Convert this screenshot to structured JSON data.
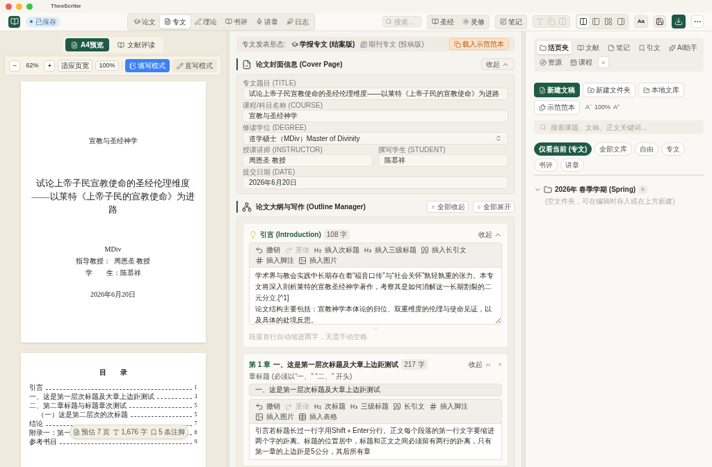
{
  "window": {
    "title": "TheoScribe"
  },
  "toolbar": {
    "save_status": "已保存",
    "modes": [
      {
        "label": "论文",
        "selected": false
      },
      {
        "label": "专文",
        "selected": true
      },
      {
        "label": "理论",
        "selected": false
      },
      {
        "label": "书评",
        "selected": false
      },
      {
        "label": "讲章",
        "selected": false
      },
      {
        "label": "日志",
        "selected": false
      }
    ],
    "search": {
      "placeholder": "搜索..."
    },
    "resources": [
      "圣经",
      "灵修"
    ],
    "notes": "笔记",
    "edit_buttons": [
      {
        "disabled": true
      },
      {
        "disabled": true
      },
      {
        "disabled": true
      }
    ],
    "layout_buttons": [
      {
        "selected": true
      },
      {
        "selected": false
      },
      {
        "selected": false
      },
      {
        "selected": false
      }
    ],
    "font_button": "Aa"
  },
  "preview": {
    "tabs": [
      {
        "label": "A4预览",
        "selected": true
      },
      {
        "label": "文献评读",
        "selected": false
      }
    ],
    "zoom": {
      "minus": "−",
      "value": "62%",
      "plus": "+",
      "fit": "适应页宽",
      "actual": "100%"
    },
    "modes": [
      {
        "label": "填写模式",
        "selected": true
      },
      {
        "label": "直写模式",
        "selected": false
      }
    ],
    "cover": {
      "course": "宣教与圣经神学",
      "title": "试论上帝子民宣教使命的圣经伦理维度",
      "subtitle": "——以莱特《上帝子民的宣教使命》为进路",
      "degree": "MDiv",
      "instructor": "指导教授：  周恩圣 教授",
      "student": "学　　生：陈慕祥",
      "date": "2026年6月20日"
    },
    "toc": {
      "title": "目　　录",
      "entries": [
        {
          "label": "引言",
          "page": "1"
        },
        {
          "label": "一、这是第一层次标题及大章上边距测试",
          "page": "3"
        },
        {
          "label": "二、第二章标题与标题章次测试",
          "page": "5",
          "children": [
            {
              "label": "（一）这是第二层次的次标题",
              "page": "5"
            }
          ]
        },
        {
          "label": "结论",
          "page": "7"
        },
        {
          "label": "附录一：第一",
          "page": "8"
        },
        {
          "label": "参考书目",
          "page": "9"
        }
      ]
    },
    "stats": [
      "预估 7 页",
      "1,676 字",
      "5 条注脚"
    ]
  },
  "editor": {
    "publish": {
      "label": "专文发表形态:",
      "options": [
        {
          "label": "学报专文 (结案版)",
          "selected": true
        },
        {
          "label": "期刊专文 (投稿版)",
          "selected": false
        }
      ],
      "load_sample": "载入示范范本"
    },
    "cover_section": {
      "title": "论文封面信息 (Cover Page)",
      "collapse": "收起",
      "fields": [
        {
          "label": "专文题目 (TITLE)",
          "value": "试论上帝子民宣教使命的圣经伦理维度——以莱特《上帝子民的宣教使命》为进路",
          "kind": "text"
        },
        {
          "label": "课程/科目名称 (COURSE)",
          "value": "宣教与圣经神学",
          "kind": "text"
        },
        {
          "label": "修读学位 (DEGREE)",
          "value": "道学硕士（MDiv）Master of Divinity",
          "kind": "select"
        },
        {
          "label": "授课讲师 (INSTRUCTOR)",
          "value": "周恩圣 教授",
          "kind": "half"
        },
        {
          "label": "撰写学生 (STUDENT)",
          "value": "陈慕祥",
          "kind": "half"
        },
        {
          "label": "提交日期 (DATE)",
          "value": "2026年6月20日",
          "kind": "text"
        }
      ]
    },
    "outline": {
      "title": "论文大纲与写作 (Outline Manager)",
      "collapse_all": "全部收起",
      "expand_all": "全部展开",
      "intro": {
        "title": "引言 (Introduction)",
        "count": "108 字",
        "collapse": "收起",
        "tools": [
          {
            "kind": "undo",
            "label": "撤销",
            "disabled": false
          },
          {
            "kind": "redo",
            "label": "重做",
            "disabled": true
          },
          {
            "kind": "h2",
            "label": "插入次标题",
            "disabled": false
          },
          {
            "kind": "h3",
            "label": "插入三级标题",
            "disabled": false
          },
          {
            "kind": "quote",
            "label": "插入长引文",
            "disabled": false
          },
          {
            "kind": "hash",
            "label": "插入脚注",
            "disabled": false
          },
          {
            "kind": "image",
            "label": "插入图片",
            "disabled": false
          }
        ],
        "text": "学术界与教会实践中长期存在着“福音口传”与“社会关怀”孰轻孰重的张力。本专文将深入剖析莱特的宣教圣经神学著作，考察其是如何消解这一长期割裂的二元分立.[^1]\n论文结构主要包括：宣教神学本体论的归位、双重维度的伦理与使命见证，以及具体的处境反思。",
        "hint": "段落首行自动缩进两字，无需手动空格"
      },
      "chapter": {
        "number": "第 1 章",
        "title": "一、这是第一层次标题及大章上边距测试",
        "count": "217 字",
        "collapse": "收起",
        "close": "×",
        "field_label": "章标题 (必须以“一、” “二、” 开头)",
        "field_value": "一、这是第一层次标题及大章上边距测试",
        "tools": [
          {
            "kind": "undo",
            "label": "撤销",
            "disabled": false
          },
          {
            "kind": "redo",
            "label": "重做",
            "disabled": true
          },
          {
            "kind": "h2",
            "label": "次标题",
            "disabled": false
          },
          {
            "kind": "h3",
            "label": "三级标题",
            "disabled": false
          },
          {
            "kind": "quote",
            "label": "长引文",
            "disabled": false
          },
          {
            "kind": "hash",
            "label": "插入脚注",
            "disabled": false
          },
          {
            "kind": "image",
            "label": "插入图片",
            "disabled": false
          },
          {
            "kind": "table",
            "label": "插入表格",
            "disabled": false
          }
        ],
        "text": "引言若标题长过一行字用Shift＋Enter分行。正文每个段落的第一行文字要缩进两个字的距离。标题的位置居中，标题和正文之间必须留有两行的距离，只有第一章的上边距是5公分，其后所有章"
      }
    }
  },
  "library": {
    "tabs": [
      {
        "label": "活页夹",
        "selected": true
      },
      {
        "label": "文献",
        "selected": false
      },
      {
        "label": "笔记",
        "selected": false
      },
      {
        "label": "引文",
        "selected": false
      },
      {
        "label": "AI助手",
        "selected": false
      },
      {
        "label": "资源",
        "selected": false
      },
      {
        "label": "课程",
        "selected": false
      }
    ],
    "more": "»",
    "actions": [
      {
        "label": "新建文稿",
        "kind": "primary"
      },
      {
        "label": "新建文件夹",
        "kind": "normal"
      },
      {
        "label": "本地文库",
        "kind": "normal"
      },
      {
        "label": "示范范本",
        "kind": "normal"
      }
    ],
    "font_size": {
      "decrease": "A⁻",
      "value": "100%",
      "increase": "A⁺"
    },
    "search": {
      "placeholder": "搜索课题、文稿、正文关键词..."
    },
    "filters": [
      {
        "label": "仅看当前 (专文)",
        "selected": true
      },
      {
        "label": "全部文库",
        "selected": false
      },
      {
        "label": "自由",
        "selected": false
      },
      {
        "label": "专文",
        "selected": false
      },
      {
        "label": "书评",
        "selected": false
      },
      {
        "label": "讲章",
        "selected": false
      }
    ],
    "folder": {
      "name": "2026年 春季学期 (Spring)",
      "count": "0",
      "expanded": true,
      "hint": "(空文件夹，可在编辑时存入或在上方新建)"
    }
  }
}
